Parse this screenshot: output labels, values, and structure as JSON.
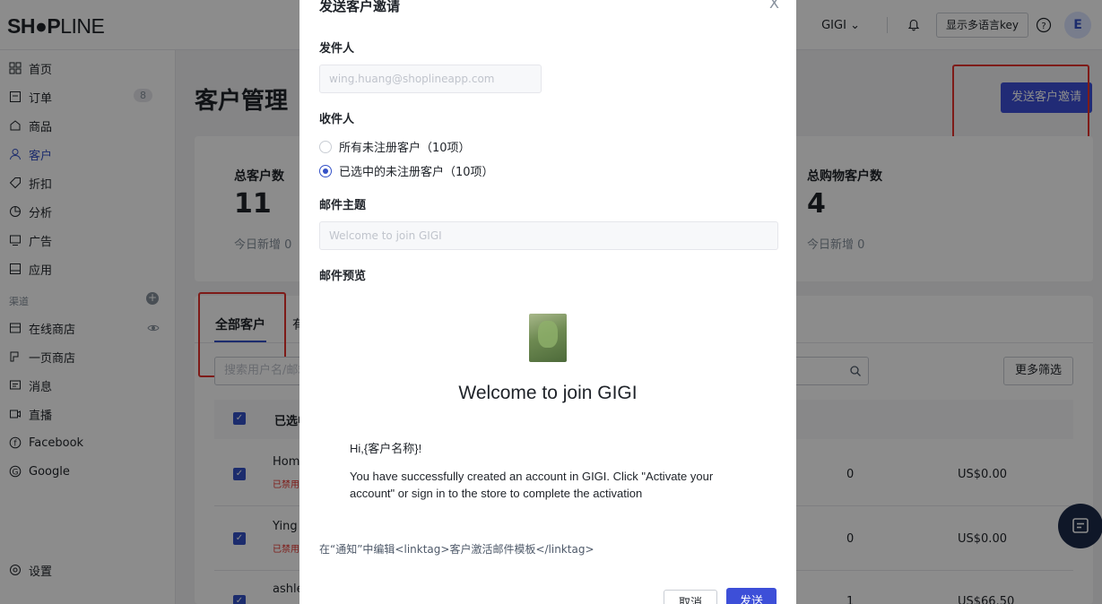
{
  "header": {
    "logo_bold": "SH●P",
    "logo_thin": "LINE",
    "store_name": "GIGI",
    "lang_button": "显示多语言key",
    "avatar_letter": "E"
  },
  "sidebar": {
    "items": [
      {
        "label": "首页"
      },
      {
        "label": "订单",
        "badge": "8"
      },
      {
        "label": "商品"
      },
      {
        "label": "客户"
      },
      {
        "label": "折扣"
      },
      {
        "label": "分析"
      },
      {
        "label": "广告"
      },
      {
        "label": "应用"
      }
    ],
    "channels_label": "渠道",
    "channels": [
      {
        "label": "在线商店"
      },
      {
        "label": "一页商店"
      },
      {
        "label": "消息"
      },
      {
        "label": "直播"
      },
      {
        "label": "Facebook"
      },
      {
        "label": "Google"
      }
    ],
    "settings": "设置"
  },
  "page": {
    "title": "客户管理",
    "invite_button": "发送客户邀请",
    "stats": {
      "total_label": "总客户数",
      "total_value": "11",
      "total_sub": "今日新增 0",
      "buyers_label": "总购物客户数",
      "buyers_value": "4",
      "buyers_sub": "今日新增 0"
    },
    "tabs": {
      "all": "全部客户",
      "second": "有"
    },
    "search_placeholder": "搜索用户名/邮箱",
    "more_filters": "更多筛选",
    "table": {
      "selected_header": "已选中",
      "rows": [
        {
          "name": "Home",
          "status": "已禁用",
          "orders": "0",
          "amount": "US$0.00"
        },
        {
          "name": "Ying",
          "status": "已禁用",
          "orders": "0",
          "amount": "US$0.00"
        },
        {
          "name": "ashle",
          "status": "",
          "orders": "1",
          "amount": "US$66.50"
        }
      ]
    }
  },
  "modal": {
    "title": "发送客户邀请",
    "close": "X",
    "sender_label": "发件人",
    "sender_placeholder": "wing.huang@shoplineapp.com",
    "recipient_label": "收件人",
    "radio_all": "所有未注册客户（10项）",
    "radio_selected": "已选中的未注册客户（10项）",
    "subject_label": "邮件主题",
    "subject_placeholder": "Welcome to join GIGI",
    "preview_label": "邮件预览",
    "email_title": "Welcome to join GIGI",
    "email_greeting": "Hi,{客户名称}!",
    "email_body": "You have successfully created an account in GIGI. Click \"Activate your account\" or sign in to the store to complete the activation",
    "edit_link": "在“通知”中编辑<linktag>客户激活邮件模板</linktag>",
    "cancel_button": "取消",
    "send_button": "发送"
  },
  "colors": {
    "primary": "#3d4fd8",
    "highlight": "#e5322d",
    "overlay": "rgba(0,0,0,0.45)"
  }
}
